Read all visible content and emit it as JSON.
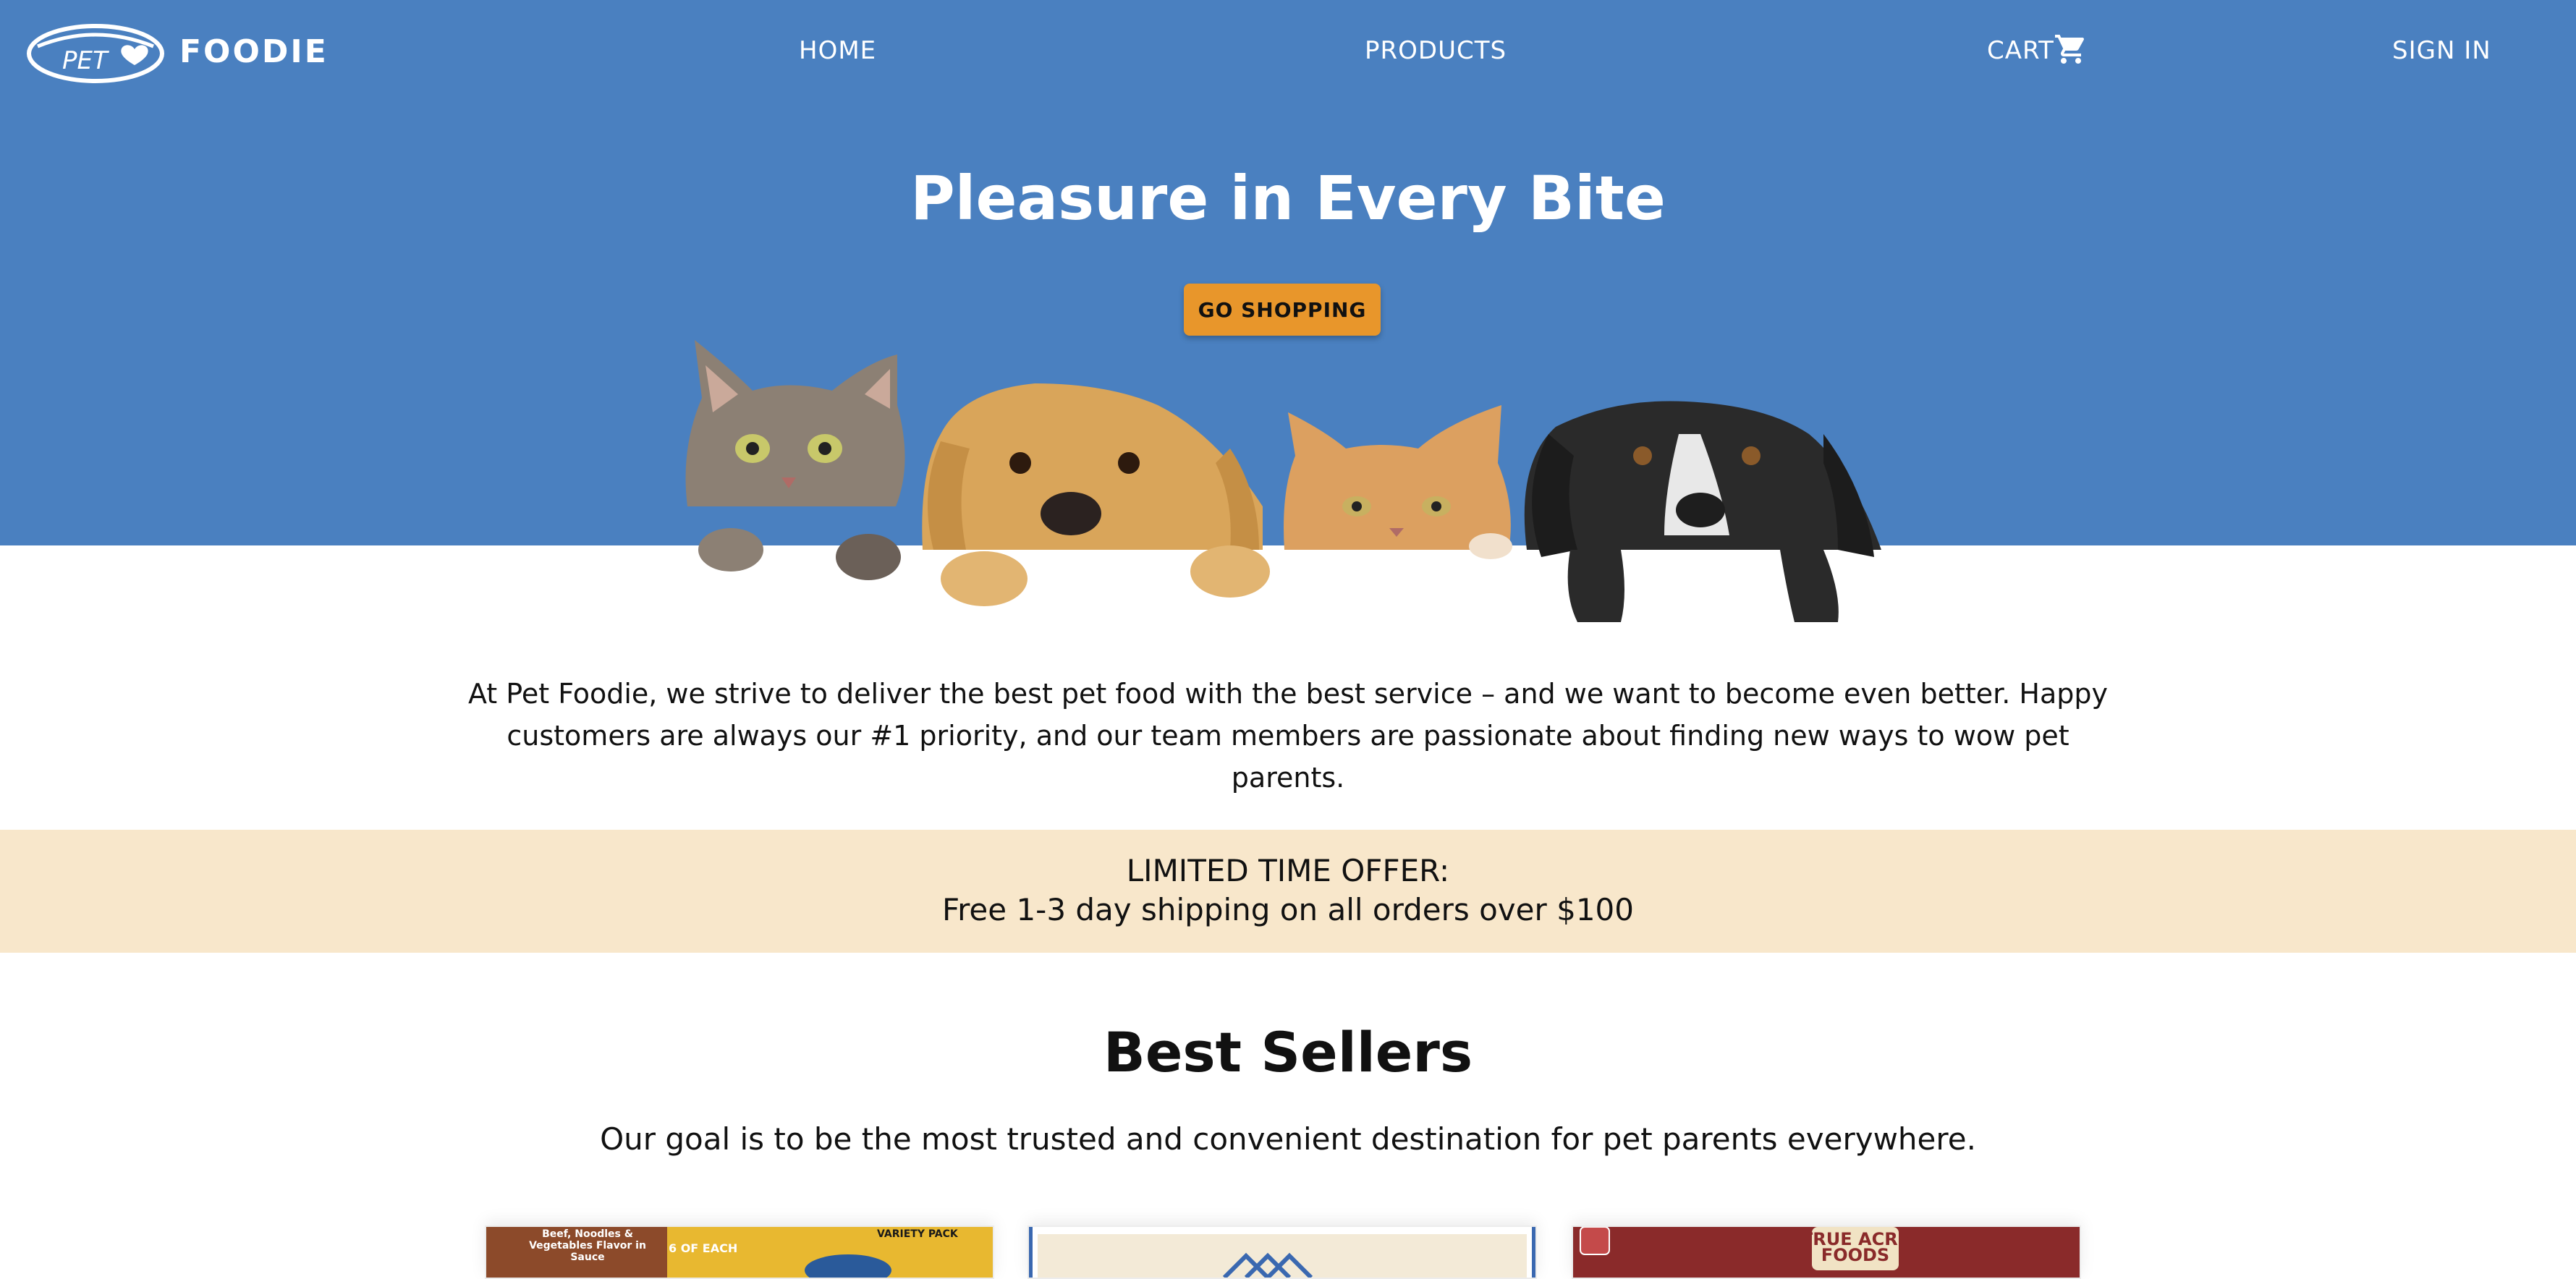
{
  "header": {
    "brand": {
      "logo_word": "PET",
      "name": "FOODIE"
    },
    "nav": {
      "home": "HOME",
      "products": "PRODUCTS",
      "cart": "CART",
      "sign_in": "SIGN IN"
    }
  },
  "hero": {
    "title": "Pleasure in Every Bite",
    "cta_label": "GO SHOPPING"
  },
  "about": {
    "text": "At Pet Foodie, we strive to deliver the best pet food with the best service – and we want to become even better. Happy customers are always our #1 priority, and our team members are passionate about finding new ways to wow pet parents."
  },
  "offer": {
    "line1": "LIMITED TIME OFFER:",
    "line2": "Free 1-3 day shipping on all orders over $100"
  },
  "best_sellers": {
    "title": "Best Sellers",
    "subtitle": "Our goal is to be the most trusted and convenient destination for pet parents everywhere.",
    "products": [
      {
        "badge_text": "Beef, Noodles & Vegetables Flavor in Sauce",
        "pack": "6 OF EACH",
        "tag": "VARIETY PACK"
      },
      {
        "badge_text": ""
      },
      {
        "badge_text": "TRUE ACRE FOODS"
      }
    ]
  },
  "colors": {
    "hero_bg": "#4a80c0",
    "cta": "#e8962b",
    "offer_bg": "#f8e7cb"
  },
  "icons": {
    "cart": "shopping-cart-icon",
    "logo": "pet-bowl-heart-icon"
  }
}
